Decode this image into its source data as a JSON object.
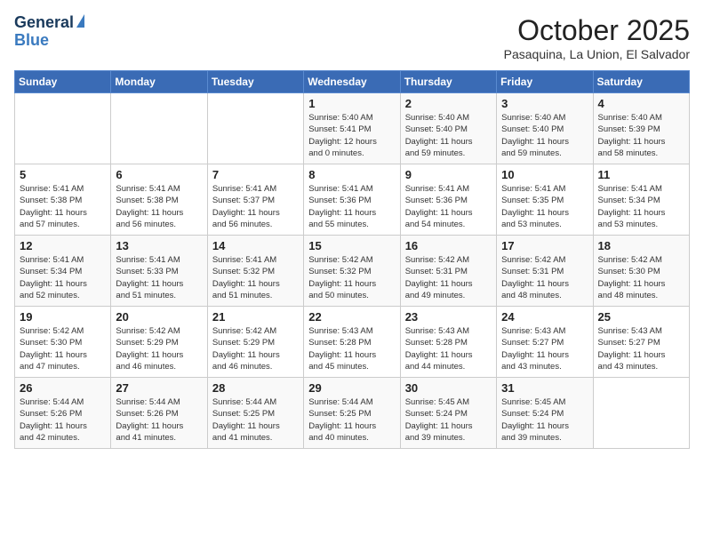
{
  "logo": {
    "line1": "General",
    "line2": "Blue"
  },
  "title": "October 2025",
  "location": "Pasaquina, La Union, El Salvador",
  "days_of_week": [
    "Sunday",
    "Monday",
    "Tuesday",
    "Wednesday",
    "Thursday",
    "Friday",
    "Saturday"
  ],
  "weeks": [
    [
      {
        "day": "",
        "info": ""
      },
      {
        "day": "",
        "info": ""
      },
      {
        "day": "",
        "info": ""
      },
      {
        "day": "1",
        "info": "Sunrise: 5:40 AM\nSunset: 5:41 PM\nDaylight: 12 hours\nand 0 minutes."
      },
      {
        "day": "2",
        "info": "Sunrise: 5:40 AM\nSunset: 5:40 PM\nDaylight: 11 hours\nand 59 minutes."
      },
      {
        "day": "3",
        "info": "Sunrise: 5:40 AM\nSunset: 5:40 PM\nDaylight: 11 hours\nand 59 minutes."
      },
      {
        "day": "4",
        "info": "Sunrise: 5:40 AM\nSunset: 5:39 PM\nDaylight: 11 hours\nand 58 minutes."
      }
    ],
    [
      {
        "day": "5",
        "info": "Sunrise: 5:41 AM\nSunset: 5:38 PM\nDaylight: 11 hours\nand 57 minutes."
      },
      {
        "day": "6",
        "info": "Sunrise: 5:41 AM\nSunset: 5:38 PM\nDaylight: 11 hours\nand 56 minutes."
      },
      {
        "day": "7",
        "info": "Sunrise: 5:41 AM\nSunset: 5:37 PM\nDaylight: 11 hours\nand 56 minutes."
      },
      {
        "day": "8",
        "info": "Sunrise: 5:41 AM\nSunset: 5:36 PM\nDaylight: 11 hours\nand 55 minutes."
      },
      {
        "day": "9",
        "info": "Sunrise: 5:41 AM\nSunset: 5:36 PM\nDaylight: 11 hours\nand 54 minutes."
      },
      {
        "day": "10",
        "info": "Sunrise: 5:41 AM\nSunset: 5:35 PM\nDaylight: 11 hours\nand 53 minutes."
      },
      {
        "day": "11",
        "info": "Sunrise: 5:41 AM\nSunset: 5:34 PM\nDaylight: 11 hours\nand 53 minutes."
      }
    ],
    [
      {
        "day": "12",
        "info": "Sunrise: 5:41 AM\nSunset: 5:34 PM\nDaylight: 11 hours\nand 52 minutes."
      },
      {
        "day": "13",
        "info": "Sunrise: 5:41 AM\nSunset: 5:33 PM\nDaylight: 11 hours\nand 51 minutes."
      },
      {
        "day": "14",
        "info": "Sunrise: 5:41 AM\nSunset: 5:32 PM\nDaylight: 11 hours\nand 51 minutes."
      },
      {
        "day": "15",
        "info": "Sunrise: 5:42 AM\nSunset: 5:32 PM\nDaylight: 11 hours\nand 50 minutes."
      },
      {
        "day": "16",
        "info": "Sunrise: 5:42 AM\nSunset: 5:31 PM\nDaylight: 11 hours\nand 49 minutes."
      },
      {
        "day": "17",
        "info": "Sunrise: 5:42 AM\nSunset: 5:31 PM\nDaylight: 11 hours\nand 48 minutes."
      },
      {
        "day": "18",
        "info": "Sunrise: 5:42 AM\nSunset: 5:30 PM\nDaylight: 11 hours\nand 48 minutes."
      }
    ],
    [
      {
        "day": "19",
        "info": "Sunrise: 5:42 AM\nSunset: 5:30 PM\nDaylight: 11 hours\nand 47 minutes."
      },
      {
        "day": "20",
        "info": "Sunrise: 5:42 AM\nSunset: 5:29 PM\nDaylight: 11 hours\nand 46 minutes."
      },
      {
        "day": "21",
        "info": "Sunrise: 5:42 AM\nSunset: 5:29 PM\nDaylight: 11 hours\nand 46 minutes."
      },
      {
        "day": "22",
        "info": "Sunrise: 5:43 AM\nSunset: 5:28 PM\nDaylight: 11 hours\nand 45 minutes."
      },
      {
        "day": "23",
        "info": "Sunrise: 5:43 AM\nSunset: 5:28 PM\nDaylight: 11 hours\nand 44 minutes."
      },
      {
        "day": "24",
        "info": "Sunrise: 5:43 AM\nSunset: 5:27 PM\nDaylight: 11 hours\nand 43 minutes."
      },
      {
        "day": "25",
        "info": "Sunrise: 5:43 AM\nSunset: 5:27 PM\nDaylight: 11 hours\nand 43 minutes."
      }
    ],
    [
      {
        "day": "26",
        "info": "Sunrise: 5:44 AM\nSunset: 5:26 PM\nDaylight: 11 hours\nand 42 minutes."
      },
      {
        "day": "27",
        "info": "Sunrise: 5:44 AM\nSunset: 5:26 PM\nDaylight: 11 hours\nand 41 minutes."
      },
      {
        "day": "28",
        "info": "Sunrise: 5:44 AM\nSunset: 5:25 PM\nDaylight: 11 hours\nand 41 minutes."
      },
      {
        "day": "29",
        "info": "Sunrise: 5:44 AM\nSunset: 5:25 PM\nDaylight: 11 hours\nand 40 minutes."
      },
      {
        "day": "30",
        "info": "Sunrise: 5:45 AM\nSunset: 5:24 PM\nDaylight: 11 hours\nand 39 minutes."
      },
      {
        "day": "31",
        "info": "Sunrise: 5:45 AM\nSunset: 5:24 PM\nDaylight: 11 hours\nand 39 minutes."
      },
      {
        "day": "",
        "info": ""
      }
    ]
  ]
}
